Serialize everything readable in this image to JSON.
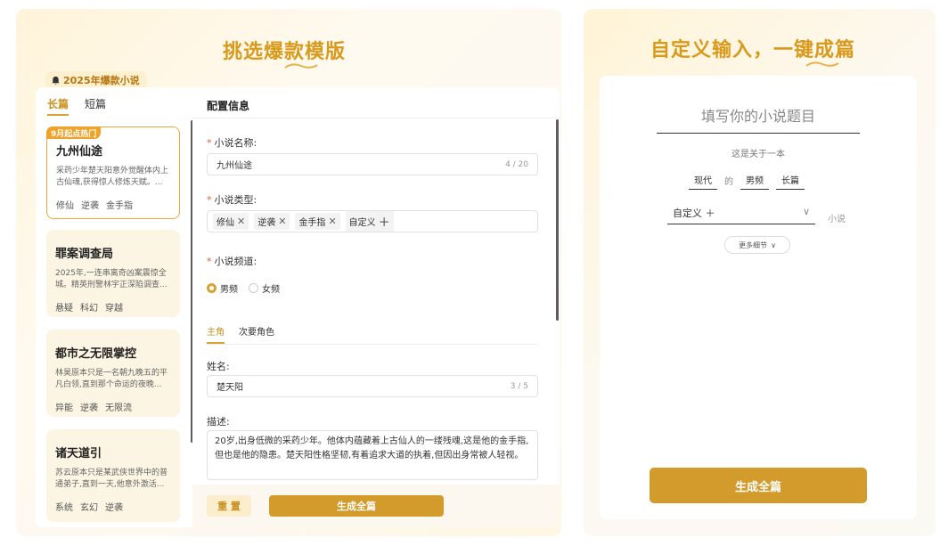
{
  "left": {
    "title": "挑选爆款模版",
    "hot_tag": "2025年爆款小说",
    "tabs": [
      {
        "label": "长篇"
      },
      {
        "label": "短篇"
      }
    ],
    "stories": [
      {
        "badge": "9月起点热门",
        "title": "九州仙途",
        "desc": "采药少年楚天阳意外觉醒体内上古仙魂,获得惊人修炼天赋。...",
        "tags": [
          "修仙",
          "逆袭",
          "金手指"
        ]
      },
      {
        "title": "罪案调查局",
        "desc": "2025年,一连串离奇凶案震惊全城。精英刑警林宇正深陷调查...",
        "tags": [
          "悬疑",
          "科幻",
          "穿越"
        ]
      },
      {
        "title": "都市之无限掌控",
        "desc": "林昊原本只是一名朝九晚五的平凡白领,直到那个命运的夜晚...",
        "tags": [
          "异能",
          "逆袭",
          "无限流"
        ]
      },
      {
        "title": "诸天道引",
        "desc": "苏云原本只是某武侠世界中的普通弟子,直到一天,他意外激活...",
        "tags": [
          "系统",
          "玄幻",
          "逆袭"
        ]
      }
    ],
    "config": {
      "header": "配置信息",
      "name_label": "小说名称:",
      "name_value": "九州仙途",
      "name_counter": "4 / 20",
      "type_label": "小说类型:",
      "type_tags": [
        "修仙",
        "逆袭",
        "金手指"
      ],
      "type_custom": "自定义",
      "channel_label": "小说频道:",
      "channel_options": [
        "男频",
        "女频"
      ],
      "role_tabs": [
        "主角",
        "次要角色"
      ],
      "hero_name_label": "姓名:",
      "hero_name_value": "楚天阳",
      "hero_name_counter": "3 / 5",
      "desc_label": "描述:",
      "desc_value": "20岁,出身低微的采药少年。他体内蕴藏着上古仙人的一缕残魂,这是他的金手指,但也是他的隐患。楚天阳性格坚韧,有着追求大道的执着,但因出身常被人轻视。",
      "reset_label": "重 置",
      "generate_label": "生成全篇"
    }
  },
  "right": {
    "title": "自定义输入，一键成篇",
    "title_placeholder": "填写你的小说题目",
    "about_label": "这是关于一本",
    "era": "现代",
    "of": "的",
    "channel": "男频",
    "length": "长篇",
    "custom_select": "自定义",
    "novel_suffix": "小说",
    "more_details": "更多细节",
    "generate_label": "生成全篇"
  },
  "colors": {
    "accent": "#d39a2c",
    "title": "#d99a1c",
    "required": "#e65a3a"
  }
}
